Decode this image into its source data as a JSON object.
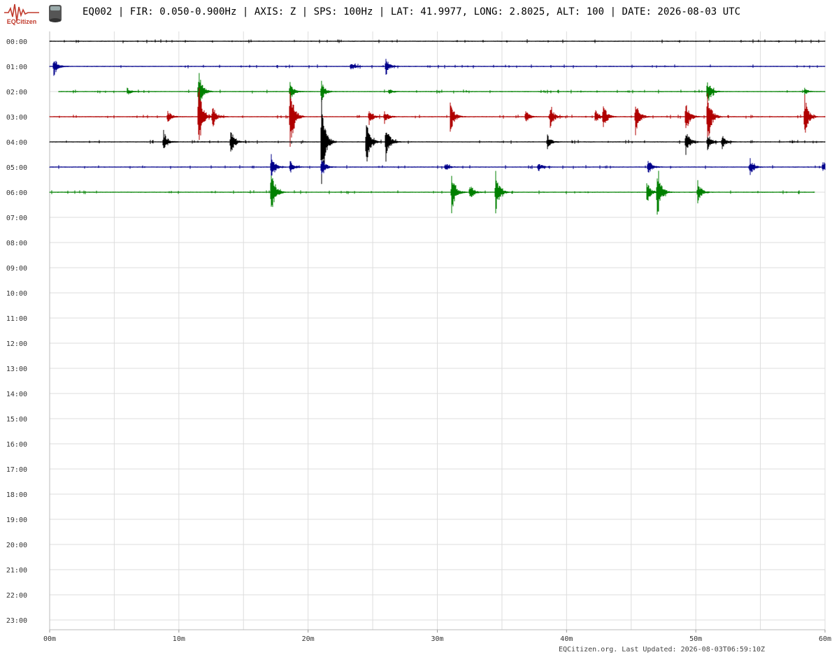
{
  "header": {
    "logo_text": "EQCitizen",
    "title": "EQ002 | FIR: 0.050-0.900Hz | AXIS: Z | SPS: 100Hz | LAT: 41.9977, LONG: 2.8025, ALT: 100 | DATE: 2026-08-03 UTC"
  },
  "footer": {
    "text": "EQCitizen.org. Last Updated: 2026-08-03T06:59:10Z"
  },
  "chart_data": {
    "type": "line",
    "title": "EQ002 | FIR: 0.050-0.900Hz | AXIS: Z | SPS: 100Hz | LAT: 41.9977, LONG: 2.8025, ALT: 100 | DATE: 2026-08-03 UTC",
    "xlabel": "",
    "ylabel": "",
    "x_ticks": [
      "00m",
      "10m",
      "20m",
      "30m",
      "40m",
      "50m",
      "60m"
    ],
    "x_range_minutes": [
      0,
      60
    ],
    "y_ticks": [
      "00:00",
      "01:00",
      "02:00",
      "03:00",
      "04:00",
      "05:00",
      "06:00",
      "07:00",
      "08:00",
      "09:00",
      "10:00",
      "11:00",
      "12:00",
      "13:00",
      "14:00",
      "15:00",
      "16:00",
      "17:00",
      "18:00",
      "19:00",
      "20:00",
      "21:00",
      "22:00",
      "23:00"
    ],
    "grid": true,
    "trace_colors": [
      "#000000",
      "#00008b",
      "#008000",
      "#b00000"
    ],
    "series": [
      {
        "hour": "00:00",
        "color": "#000000",
        "start_min": 0.0,
        "end_min": 60.0,
        "events": []
      },
      {
        "hour": "01:00",
        "color": "#00008b",
        "start_min": 0.0,
        "end_min": 60.0,
        "events": [
          {
            "min": 0.3,
            "amp": 0.45
          },
          {
            "min": 23.3,
            "amp": 0.2
          },
          {
            "min": 26.0,
            "amp": 0.35
          }
        ]
      },
      {
        "hour": "02:00",
        "color": "#008000",
        "start_min": 0.7,
        "end_min": 60.0,
        "events": [
          {
            "min": 6.0,
            "amp": 0.15
          },
          {
            "min": 11.5,
            "amp": 1.0
          },
          {
            "min": 18.6,
            "amp": 0.4
          },
          {
            "min": 21.0,
            "amp": 0.5
          },
          {
            "min": 26.3,
            "amp": 0.1
          },
          {
            "min": 50.9,
            "amp": 0.55
          },
          {
            "min": 58.4,
            "amp": 0.15
          }
        ]
      },
      {
        "hour": "03:00",
        "color": "#b00000",
        "start_min": 0.0,
        "end_min": 60.0,
        "events": [
          {
            "min": 9.1,
            "amp": 0.3
          },
          {
            "min": 11.5,
            "amp": 1.6
          },
          {
            "min": 12.6,
            "amp": 0.5
          },
          {
            "min": 18.6,
            "amp": 1.6
          },
          {
            "min": 24.7,
            "amp": 0.4
          },
          {
            "min": 25.9,
            "amp": 0.3
          },
          {
            "min": 31.0,
            "amp": 0.7
          },
          {
            "min": 36.8,
            "amp": 0.3
          },
          {
            "min": 38.7,
            "amp": 0.6
          },
          {
            "min": 42.2,
            "amp": 0.3
          },
          {
            "min": 42.8,
            "amp": 0.6
          },
          {
            "min": 45.3,
            "amp": 0.9
          },
          {
            "min": 49.2,
            "amp": 0.8
          },
          {
            "min": 50.9,
            "amp": 1.3
          },
          {
            "min": 58.4,
            "amp": 1.0
          }
        ]
      },
      {
        "hour": "04:00",
        "color": "#000000",
        "start_min": 0.0,
        "end_min": 60.0,
        "events": [
          {
            "min": 8.8,
            "amp": 0.5
          },
          {
            "min": 14.0,
            "amp": 0.55
          },
          {
            "min": 21.0,
            "amp": 2.5
          },
          {
            "min": 24.5,
            "amp": 1.2
          },
          {
            "min": 26.0,
            "amp": 0.9
          },
          {
            "min": 38.5,
            "amp": 0.3
          },
          {
            "min": 49.2,
            "amp": 0.6
          },
          {
            "min": 50.9,
            "amp": 0.4
          },
          {
            "min": 52.0,
            "amp": 0.35
          }
        ]
      },
      {
        "hour": "05:00",
        "color": "#00008b",
        "start_min": 0.0,
        "end_min": 60.0,
        "events": [
          {
            "min": 17.1,
            "amp": 0.7
          },
          {
            "min": 18.6,
            "amp": 0.3
          },
          {
            "min": 21.0,
            "amp": 0.5
          },
          {
            "min": 30.6,
            "amp": 0.2
          },
          {
            "min": 37.8,
            "amp": 0.2
          },
          {
            "min": 46.3,
            "amp": 0.35
          },
          {
            "min": 54.2,
            "amp": 0.35
          },
          {
            "min": 59.8,
            "amp": 0.3
          }
        ]
      },
      {
        "hour": "06:00",
        "color": "#008000",
        "start_min": 0.0,
        "end_min": 59.2,
        "events": [
          {
            "min": 17.1,
            "amp": 1.2
          },
          {
            "min": 31.1,
            "amp": 0.9
          },
          {
            "min": 32.5,
            "amp": 0.4
          },
          {
            "min": 34.5,
            "amp": 0.95
          },
          {
            "min": 46.2,
            "amp": 0.5
          },
          {
            "min": 47.0,
            "amp": 1.25
          },
          {
            "min": 50.1,
            "amp": 0.6
          }
        ]
      }
    ]
  }
}
